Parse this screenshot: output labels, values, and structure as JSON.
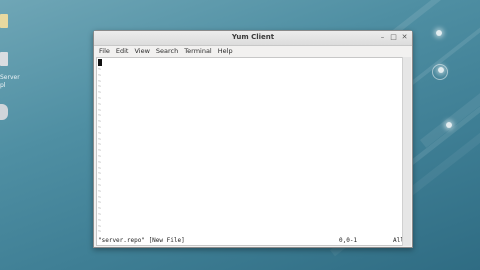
{
  "desktop": {
    "labels": [
      "Server",
      "pl"
    ]
  },
  "window": {
    "title": "Yum Client",
    "controls": [
      "–",
      "□",
      "✕"
    ]
  },
  "menubar": {
    "items": [
      "File",
      "Edit",
      "View",
      "Search",
      "Terminal",
      "Help"
    ]
  },
  "terminal": {
    "empty_line_marker": "~",
    "status": {
      "filename": "\"server.repo\" [New File]",
      "position": "0,0-1",
      "view": "All"
    }
  }
}
